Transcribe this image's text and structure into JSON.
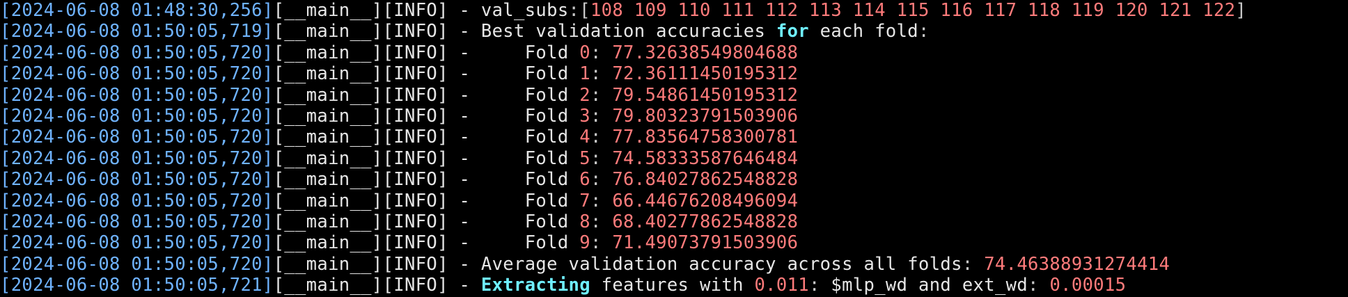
{
  "colors": {
    "background": "#000000",
    "timestamp": "#6fb3ff",
    "text": "#e6e6e6",
    "number": "#ff7b7b",
    "keyword": "#6ff0ff"
  },
  "lines": [
    {
      "timestamp": "[2024-06-08 01:48:30,256]",
      "prefix": "[__main__][INFO] - ",
      "segments": [
        {
          "text": "val_subs",
          "style": "plain"
        },
        {
          "text": ":[",
          "style": "punct"
        },
        {
          "text": "108 109 110 111 112 113 114 115 116 117 118 119 120 121 122",
          "style": "num"
        },
        {
          "text": "]",
          "style": "punct"
        }
      ]
    },
    {
      "timestamp": "[2024-06-08 01:50:05,719]",
      "prefix": "[__main__][INFO] - ",
      "segments": [
        {
          "text": "Best validation accuracies ",
          "style": "plain"
        },
        {
          "text": "for",
          "style": "kw"
        },
        {
          "text": " each fold",
          "style": "plain"
        },
        {
          "text": ":",
          "style": "punct"
        }
      ]
    },
    {
      "timestamp": "[2024-06-08 01:50:05,720]",
      "prefix": "[__main__][INFO] - ",
      "segments": [
        {
          "text": "    Fold ",
          "style": "plain"
        },
        {
          "text": "0",
          "style": "num"
        },
        {
          "text": ": ",
          "style": "punct"
        },
        {
          "text": "77.32638549804688",
          "style": "num"
        }
      ]
    },
    {
      "timestamp": "[2024-06-08 01:50:05,720]",
      "prefix": "[__main__][INFO] - ",
      "segments": [
        {
          "text": "    Fold ",
          "style": "plain"
        },
        {
          "text": "1",
          "style": "num"
        },
        {
          "text": ": ",
          "style": "punct"
        },
        {
          "text": "72.36111450195312",
          "style": "num"
        }
      ]
    },
    {
      "timestamp": "[2024-06-08 01:50:05,720]",
      "prefix": "[__main__][INFO] - ",
      "segments": [
        {
          "text": "    Fold ",
          "style": "plain"
        },
        {
          "text": "2",
          "style": "num"
        },
        {
          "text": ": ",
          "style": "punct"
        },
        {
          "text": "79.54861450195312",
          "style": "num"
        }
      ]
    },
    {
      "timestamp": "[2024-06-08 01:50:05,720]",
      "prefix": "[__main__][INFO] - ",
      "segments": [
        {
          "text": "    Fold ",
          "style": "plain"
        },
        {
          "text": "3",
          "style": "num"
        },
        {
          "text": ": ",
          "style": "punct"
        },
        {
          "text": "79.80323791503906",
          "style": "num"
        }
      ]
    },
    {
      "timestamp": "[2024-06-08 01:50:05,720]",
      "prefix": "[__main__][INFO] - ",
      "segments": [
        {
          "text": "    Fold ",
          "style": "plain"
        },
        {
          "text": "4",
          "style": "num"
        },
        {
          "text": ": ",
          "style": "punct"
        },
        {
          "text": "77.83564758300781",
          "style": "num"
        }
      ]
    },
    {
      "timestamp": "[2024-06-08 01:50:05,720]",
      "prefix": "[__main__][INFO] - ",
      "segments": [
        {
          "text": "    Fold ",
          "style": "plain"
        },
        {
          "text": "5",
          "style": "num"
        },
        {
          "text": ": ",
          "style": "punct"
        },
        {
          "text": "74.58333587646484",
          "style": "num"
        }
      ]
    },
    {
      "timestamp": "[2024-06-08 01:50:05,720]",
      "prefix": "[__main__][INFO] - ",
      "segments": [
        {
          "text": "    Fold ",
          "style": "plain"
        },
        {
          "text": "6",
          "style": "num"
        },
        {
          "text": ": ",
          "style": "punct"
        },
        {
          "text": "76.84027862548828",
          "style": "num"
        }
      ]
    },
    {
      "timestamp": "[2024-06-08 01:50:05,720]",
      "prefix": "[__main__][INFO] - ",
      "segments": [
        {
          "text": "    Fold ",
          "style": "plain"
        },
        {
          "text": "7",
          "style": "num"
        },
        {
          "text": ": ",
          "style": "punct"
        },
        {
          "text": "66.44676208496094",
          "style": "num"
        }
      ]
    },
    {
      "timestamp": "[2024-06-08 01:50:05,720]",
      "prefix": "[__main__][INFO] - ",
      "segments": [
        {
          "text": "    Fold ",
          "style": "plain"
        },
        {
          "text": "8",
          "style": "num"
        },
        {
          "text": ": ",
          "style": "punct"
        },
        {
          "text": "68.40277862548828",
          "style": "num"
        }
      ]
    },
    {
      "timestamp": "[2024-06-08 01:50:05,720]",
      "prefix": "[__main__][INFO] - ",
      "segments": [
        {
          "text": "    Fold ",
          "style": "plain"
        },
        {
          "text": "9",
          "style": "num"
        },
        {
          "text": ": ",
          "style": "punct"
        },
        {
          "text": "71.49073791503906",
          "style": "num"
        }
      ]
    },
    {
      "timestamp": "[2024-06-08 01:50:05,720]",
      "prefix": "[__main__][INFO] - ",
      "segments": [
        {
          "text": "Average validation accuracy across all folds",
          "style": "plain"
        },
        {
          "text": ": ",
          "style": "punct"
        },
        {
          "text": "74.46388931274414",
          "style": "num"
        }
      ]
    },
    {
      "timestamp": "[2024-06-08 01:50:05,721]",
      "prefix": "[__main__][INFO] - ",
      "segments": [
        {
          "text": "Extracting",
          "style": "kw"
        },
        {
          "text": " features with ",
          "style": "plain"
        },
        {
          "text": "0.011",
          "style": "num"
        },
        {
          "text": ": ",
          "style": "punct"
        },
        {
          "text": "$mlp_wd and ext_wd",
          "style": "plain"
        },
        {
          "text": ": ",
          "style": "punct"
        },
        {
          "text": "0.00015",
          "style": "num"
        }
      ]
    }
  ]
}
